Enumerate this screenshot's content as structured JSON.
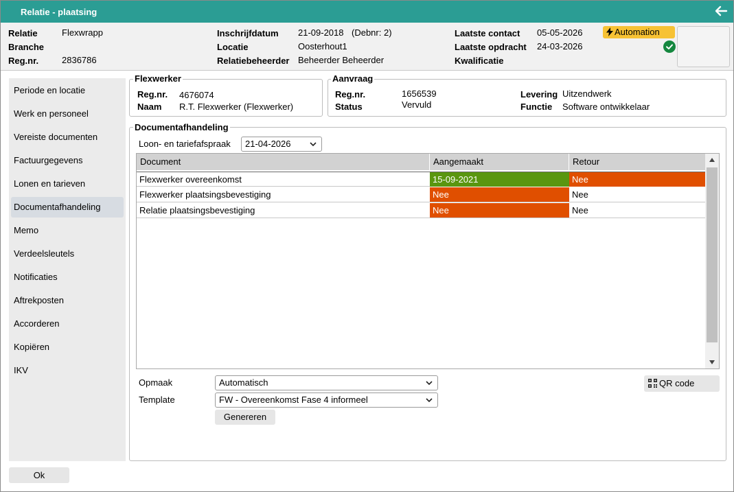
{
  "window": {
    "title": "Relatie - plaatsing"
  },
  "header": {
    "col1": [
      {
        "label": "Relatie",
        "value": "Flexwrapp"
      },
      {
        "label": "Branche",
        "value": ""
      },
      {
        "label": "Reg.nr.",
        "value": "2836786"
      }
    ],
    "col2": [
      {
        "label": "Inschrijfdatum",
        "value": "21-09-2018",
        "extra": "(Debnr: 2)"
      },
      {
        "label": "Locatie",
        "value": "Oosterhout1"
      },
      {
        "label": "Relatiebeheerder",
        "value": "Beheerder Beheerder"
      }
    ],
    "col3": [
      {
        "label": "Laatste contact",
        "value": "05-05-2026"
      },
      {
        "label": "Laatste opdracht",
        "value": "24-03-2026"
      },
      {
        "label": "Kwalificatie",
        "value": ""
      }
    ],
    "badge": "Automation"
  },
  "sidebar": {
    "items": [
      {
        "label": "Periode en locatie"
      },
      {
        "label": "Werk en personeel"
      },
      {
        "label": "Vereiste documenten"
      },
      {
        "label": "Factuurgegevens"
      },
      {
        "label": "Lonen en tarieven"
      },
      {
        "label": "Documentafhandeling",
        "active": true
      },
      {
        "label": "Memo"
      },
      {
        "label": "Verdeelsleutels"
      },
      {
        "label": "Notificaties"
      },
      {
        "label": "Aftrekposten"
      },
      {
        "label": "Accorderen"
      },
      {
        "label": "Kopiëren"
      },
      {
        "label": "IKV"
      }
    ]
  },
  "flexwerker": {
    "legend": "Flexwerker",
    "regnr_label": "Reg.nr.",
    "regnr": "4676074",
    "naam_label": "Naam",
    "naam": "R.T. Flexwerker (Flexwerker)"
  },
  "aanvraag": {
    "legend": "Aanvraag",
    "regnr_label": "Reg.nr.",
    "regnr": "1656539",
    "status_label": "Status",
    "status": "Vervuld",
    "levering_label": "Levering",
    "levering": "Uitzendwerk",
    "functie_label": "Functie",
    "functie": "Software ontwikkelaar"
  },
  "documentafhandeling": {
    "legend": "Documentafhandeling",
    "loon_label": "Loon- en tariefafspraak",
    "loon_value": "21-04-2026",
    "columns": [
      "Document",
      "Aangemaakt",
      "Retour"
    ],
    "rows": [
      {
        "document": "Flexwerker overeenkomst",
        "aangemaakt": "15-09-2021",
        "retour": "Nee"
      },
      {
        "document": "Flexwerker plaatsingsbevestiging",
        "aangemaakt": "Nee",
        "retour": "Nee"
      },
      {
        "document": "Relatie plaatsingsbevestiging",
        "aangemaakt": "Nee",
        "retour": "Nee"
      }
    ],
    "opmaak_label": "Opmaak",
    "opmaak_value": "Automatisch",
    "template_label": "Template",
    "template_value": "FW - Overeenkomst Fase 4 informeel",
    "genereren_label": "Genereren",
    "qr_label": "QR code"
  },
  "footer": {
    "ok_label": "Ok"
  },
  "colors": {
    "titlebar": "#2b9d94",
    "green": "#5a9610",
    "orange": "#e04f00",
    "badge": "#f7c234",
    "check": "#15873f"
  }
}
